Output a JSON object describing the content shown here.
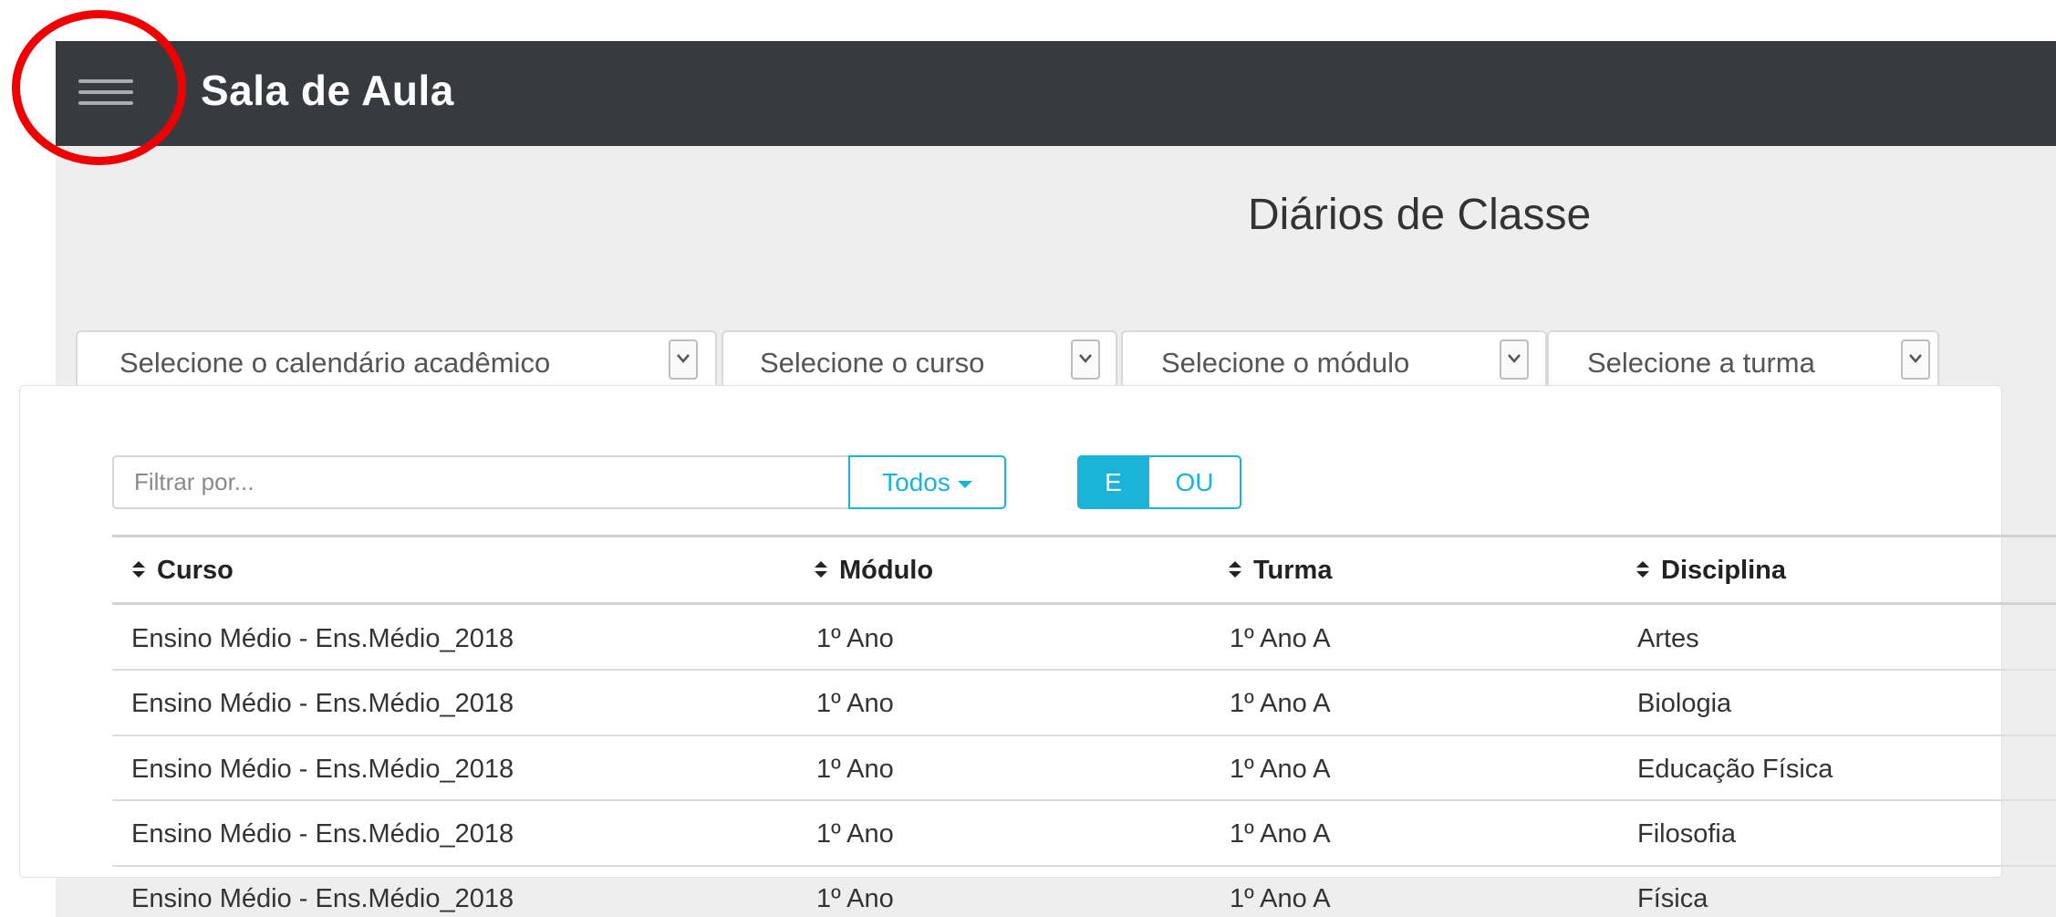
{
  "header": {
    "app_title": "Sala de Aula",
    "menu_icon": "hamburger-menu-icon",
    "background_color": "#373b3f"
  },
  "annotation": {
    "shape": "circle",
    "color": "#f00000"
  },
  "page": {
    "title": "Diários de Classe"
  },
  "filters": {
    "calendar": "Selecione o calendário acadêmico",
    "course": "Selecione o curso",
    "module": "Selecione o módulo",
    "class": "Selecione a turma"
  },
  "search": {
    "placeholder": "Filtrar por...",
    "scope_button": "Todos",
    "logic_and": "E",
    "logic_or": "OU",
    "logic_selected": "E",
    "accent_color": "#1bb3d8"
  },
  "table": {
    "columns": [
      "Curso",
      "Módulo",
      "Turma",
      "Disciplina"
    ],
    "rows": [
      [
        "Ensino Médio - Ens.Médio_2018",
        "1º Ano",
        "1º Ano A",
        "Artes"
      ],
      [
        "Ensino Médio - Ens.Médio_2018",
        "1º Ano",
        "1º Ano A",
        "Biologia"
      ],
      [
        "Ensino Médio - Ens.Médio_2018",
        "1º Ano",
        "1º Ano A",
        "Educação Física"
      ],
      [
        "Ensino Médio - Ens.Médio_2018",
        "1º Ano",
        "1º Ano A",
        "Filosofia"
      ],
      [
        "Ensino Médio - Ens.Médio_2018",
        "1º Ano",
        "1º Ano A",
        "Física"
      ]
    ]
  }
}
